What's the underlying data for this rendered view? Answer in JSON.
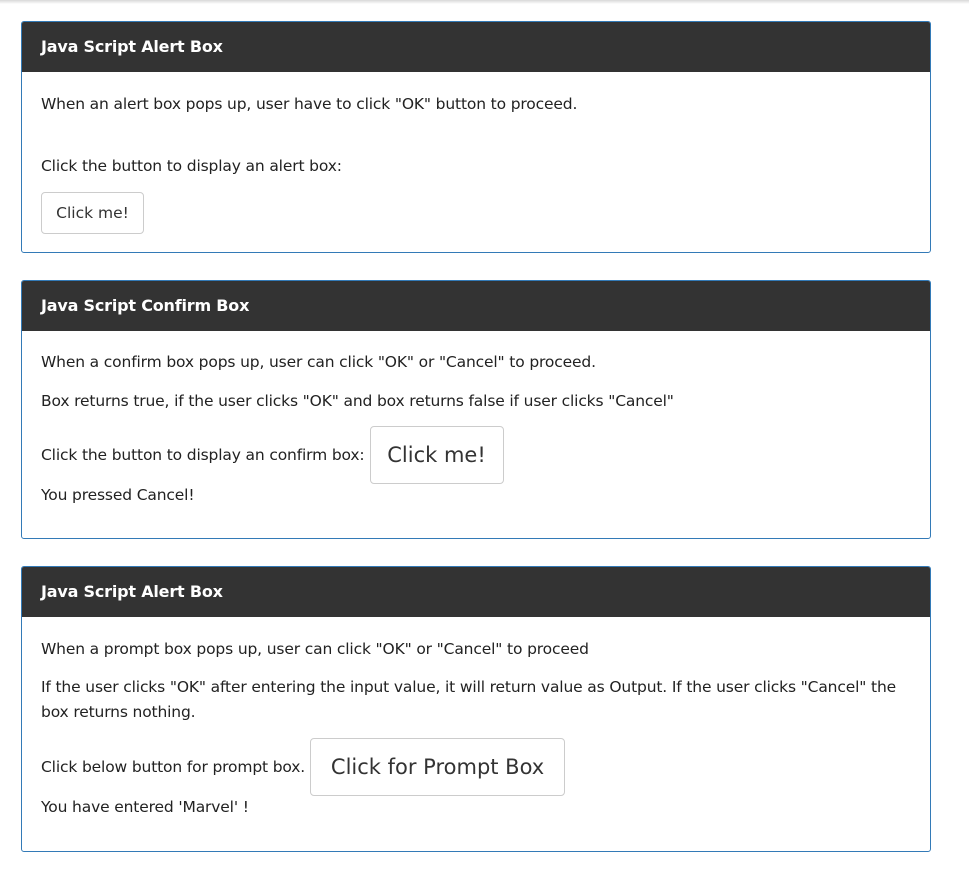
{
  "alert_panel": {
    "title": "Java Script Alert Box",
    "description": "When an alert box pops up, user have to click \"OK\" button to proceed.",
    "instruction": "Click the button to display an alert box:",
    "button_label": "Click me!"
  },
  "confirm_panel": {
    "title": "Java Script Confirm Box",
    "description": "When a confirm box pops up, user can click \"OK\" or \"Cancel\" to proceed.",
    "returns_info": "Box returns true, if the user clicks \"OK\" and box returns false if user clicks \"Cancel\"",
    "instruction": "Click the button to display an confirm box:",
    "button_label": "Click me!",
    "result": "You pressed Cancel!"
  },
  "prompt_panel": {
    "title": "Java Script Alert Box",
    "description": "When a prompt box pops up, user can click \"OK\" or \"Cancel\" to proceed",
    "returns_info": "If the user clicks \"OK\" after entering the input value, it will return value as Output. If the user clicks \"Cancel\" the box returns nothing.",
    "instruction": "Click below button for prompt box.",
    "button_label": "Click for Prompt Box",
    "result": "You have entered 'Marvel' !"
  }
}
